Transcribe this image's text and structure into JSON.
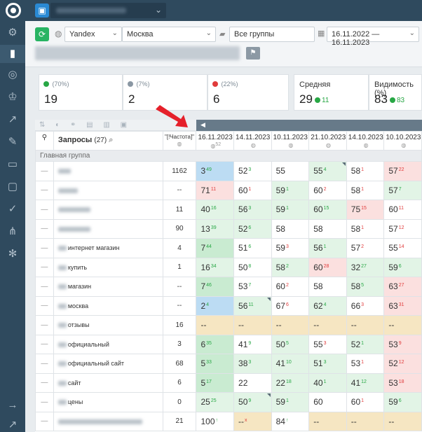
{
  "topbar": {
    "project_icon": "briefcase-icon"
  },
  "filters": {
    "engine": "Yandex",
    "region": "Москва",
    "group": "Все группы",
    "date_range": "16.11.2022 — 16.11.2023"
  },
  "cards": {
    "card1": {
      "pct": "(70%)",
      "value": "19",
      "color": "#28a745"
    },
    "card2": {
      "pct": "(7%)",
      "value": "2",
      "color": "#8a97a3"
    },
    "card3": {
      "pct": "(22%)",
      "value": "6",
      "color": "#e03b3b"
    },
    "avg": {
      "title": "Средняя",
      "value": "29",
      "delta": "11"
    },
    "vis": {
      "title": "Видимость (%)",
      "value": "83",
      "delta": "83"
    }
  },
  "table": {
    "query_header": "Запросы",
    "query_count": "(27)",
    "freq_header": "\"[!Частота]\"",
    "dates": [
      {
        "date": "16.11.2023",
        "sub": "52"
      },
      {
        "date": "14.11.2023",
        "sub": ""
      },
      {
        "date": "10.11.2023",
        "sub": ""
      },
      {
        "date": "21.10.2023",
        "sub": ""
      },
      {
        "date": "14.10.2023",
        "sub": ""
      },
      {
        "date": "10.10.2023",
        "sub": ""
      }
    ],
    "group_label": "Главная группа",
    "rows": [
      {
        "q": "",
        "f": "1162",
        "cells": [
          [
            "3",
            "49",
            "up",
            "b",
            0
          ],
          [
            "52",
            "3",
            "up",
            "w",
            0
          ],
          [
            "55",
            "",
            "",
            "w",
            0
          ],
          [
            "55",
            "4",
            "up",
            "g",
            1
          ],
          [
            "58",
            "1",
            "dn",
            "w",
            0
          ],
          [
            "57",
            "22",
            "dn",
            "r",
            0
          ]
        ]
      },
      {
        "q": "",
        "f": "--",
        "cells": [
          [
            "71",
            "11",
            "dn",
            "r",
            0
          ],
          [
            "60",
            "1",
            "dn",
            "w",
            0
          ],
          [
            "59",
            "1",
            "up",
            "g",
            0
          ],
          [
            "60",
            "2",
            "dn",
            "w",
            0
          ],
          [
            "58",
            "1",
            "dn",
            "w",
            0
          ],
          [
            "57",
            "7",
            "up",
            "g",
            0
          ]
        ]
      },
      {
        "q": "",
        "f": "11",
        "cells": [
          [
            "40",
            "16",
            "up",
            "g",
            0
          ],
          [
            "56",
            "3",
            "up",
            "g",
            0
          ],
          [
            "59",
            "1",
            "up",
            "g",
            0
          ],
          [
            "60",
            "15",
            "up",
            "g",
            0
          ],
          [
            "75",
            "15",
            "dn",
            "r",
            0
          ],
          [
            "60",
            "11",
            "dn",
            "w",
            0
          ]
        ]
      },
      {
        "q": "",
        "f": "90",
        "cells": [
          [
            "13",
            "39",
            "up",
            "g",
            0
          ],
          [
            "52",
            "6",
            "up",
            "g",
            0
          ],
          [
            "58",
            "",
            "",
            "w",
            0
          ],
          [
            "58",
            "",
            "",
            "w",
            0
          ],
          [
            "58",
            "1",
            "dn",
            "w",
            0
          ],
          [
            "57",
            "12",
            "dn",
            "w",
            0
          ]
        ]
      },
      {
        "q": "интернет магазин",
        "f": "4",
        "cells": [
          [
            "7",
            "44",
            "up",
            "dg",
            0
          ],
          [
            "51",
            "6",
            "up",
            "w",
            0
          ],
          [
            "59",
            "3",
            "dn",
            "w",
            0
          ],
          [
            "56",
            "1",
            "up",
            "g",
            0
          ],
          [
            "57",
            "2",
            "dn",
            "w",
            0
          ],
          [
            "55",
            "14",
            "dn",
            "w",
            0
          ]
        ]
      },
      {
        "q": "купить",
        "f": "1",
        "cells": [
          [
            "16",
            "34",
            "up",
            "g",
            0
          ],
          [
            "50",
            "8",
            "up",
            "w",
            0
          ],
          [
            "58",
            "2",
            "up",
            "g",
            0
          ],
          [
            "60",
            "28",
            "dn",
            "r",
            0
          ],
          [
            "32",
            "27",
            "up",
            "g",
            0
          ],
          [
            "59",
            "6",
            "up",
            "g",
            0
          ]
        ]
      },
      {
        "q": "магазин",
        "f": "--",
        "cells": [
          [
            "7",
            "46",
            "up",
            "dg",
            0
          ],
          [
            "53",
            "7",
            "up",
            "w",
            0
          ],
          [
            "60",
            "2",
            "dn",
            "w",
            0
          ],
          [
            "58",
            "",
            "",
            "w",
            0
          ],
          [
            "58",
            "5",
            "up",
            "g",
            0
          ],
          [
            "63",
            "27",
            "dn",
            "r",
            0
          ]
        ]
      },
      {
        "q": "москва",
        "f": "--",
        "cells": [
          [
            "2",
            "4",
            "up",
            "b",
            0
          ],
          [
            "56",
            "11",
            "up",
            "g",
            1
          ],
          [
            "67",
            "6",
            "dn",
            "w",
            0
          ],
          [
            "62",
            "4",
            "up",
            "g",
            0
          ],
          [
            "66",
            "3",
            "dn",
            "w",
            0
          ],
          [
            "63",
            "31",
            "dn",
            "r",
            0
          ]
        ]
      },
      {
        "q": "отзывы",
        "f": "16",
        "cells": [
          [
            "--",
            "",
            "",
            "y",
            0
          ],
          [
            "--",
            "",
            "",
            "y",
            0
          ],
          [
            "--",
            "",
            "",
            "y",
            0
          ],
          [
            "--",
            "",
            "",
            "y",
            0
          ],
          [
            "--",
            "",
            "",
            "y",
            0
          ],
          [
            "--",
            "",
            "",
            "y",
            0
          ]
        ]
      },
      {
        "q": "официальный",
        "f": "3",
        "cells": [
          [
            "6",
            "35",
            "up",
            "dg",
            0
          ],
          [
            "41",
            "9",
            "up",
            "w",
            0
          ],
          [
            "50",
            "5",
            "up",
            "g",
            0
          ],
          [
            "55",
            "3",
            "dn",
            "w",
            0
          ],
          [
            "52",
            "1",
            "up",
            "g",
            0
          ],
          [
            "53",
            "9",
            "dn",
            "r",
            0
          ]
        ]
      },
      {
        "q": "официальный сайт",
        "f": "68",
        "cells": [
          [
            "5",
            "33",
            "up",
            "dg",
            0
          ],
          [
            "38",
            "3",
            "up",
            "g",
            0
          ],
          [
            "41",
            "10",
            "up",
            "g",
            0
          ],
          [
            "51",
            "3",
            "up",
            "g",
            0
          ],
          [
            "53",
            "1",
            "dn",
            "w",
            0
          ],
          [
            "52",
            "12",
            "dn",
            "r",
            0
          ]
        ]
      },
      {
        "q": "сайт",
        "f": "6",
        "cells": [
          [
            "5",
            "17",
            "up",
            "dg",
            0
          ],
          [
            "22",
            "",
            "",
            "w",
            0
          ],
          [
            "22",
            "18",
            "up",
            "g",
            0
          ],
          [
            "40",
            "1",
            "up",
            "g",
            0
          ],
          [
            "41",
            "12",
            "up",
            "g",
            0
          ],
          [
            "53",
            "18",
            "dn",
            "r",
            0
          ]
        ]
      },
      {
        "q": "цены",
        "f": "0",
        "cells": [
          [
            "25",
            "25",
            "up",
            "g",
            0
          ],
          [
            "50",
            "9",
            "up",
            "g",
            1
          ],
          [
            "59",
            "1",
            "up",
            "g",
            0
          ],
          [
            "60",
            "",
            "",
            "w",
            0
          ],
          [
            "60",
            "1",
            "dn",
            "w",
            0
          ],
          [
            "59",
            "6",
            "up",
            "g",
            0
          ]
        ]
      },
      {
        "q": "",
        "f": "21",
        "cells": [
          [
            "100",
            "↑",
            "up",
            "w",
            0
          ],
          [
            "--",
            "x",
            "dn",
            "y",
            0
          ],
          [
            "84",
            "↑",
            "up",
            "w",
            0
          ],
          [
            "--",
            "",
            "",
            "y",
            0
          ],
          [
            "--",
            "",
            "",
            "y",
            0
          ],
          [
            "--",
            "",
            "",
            "y",
            0
          ]
        ]
      }
    ]
  },
  "colors": {
    "sidebar": "#2f4a5e",
    "accent_green": "#28b463",
    "arrow_red": "#e5202a"
  }
}
